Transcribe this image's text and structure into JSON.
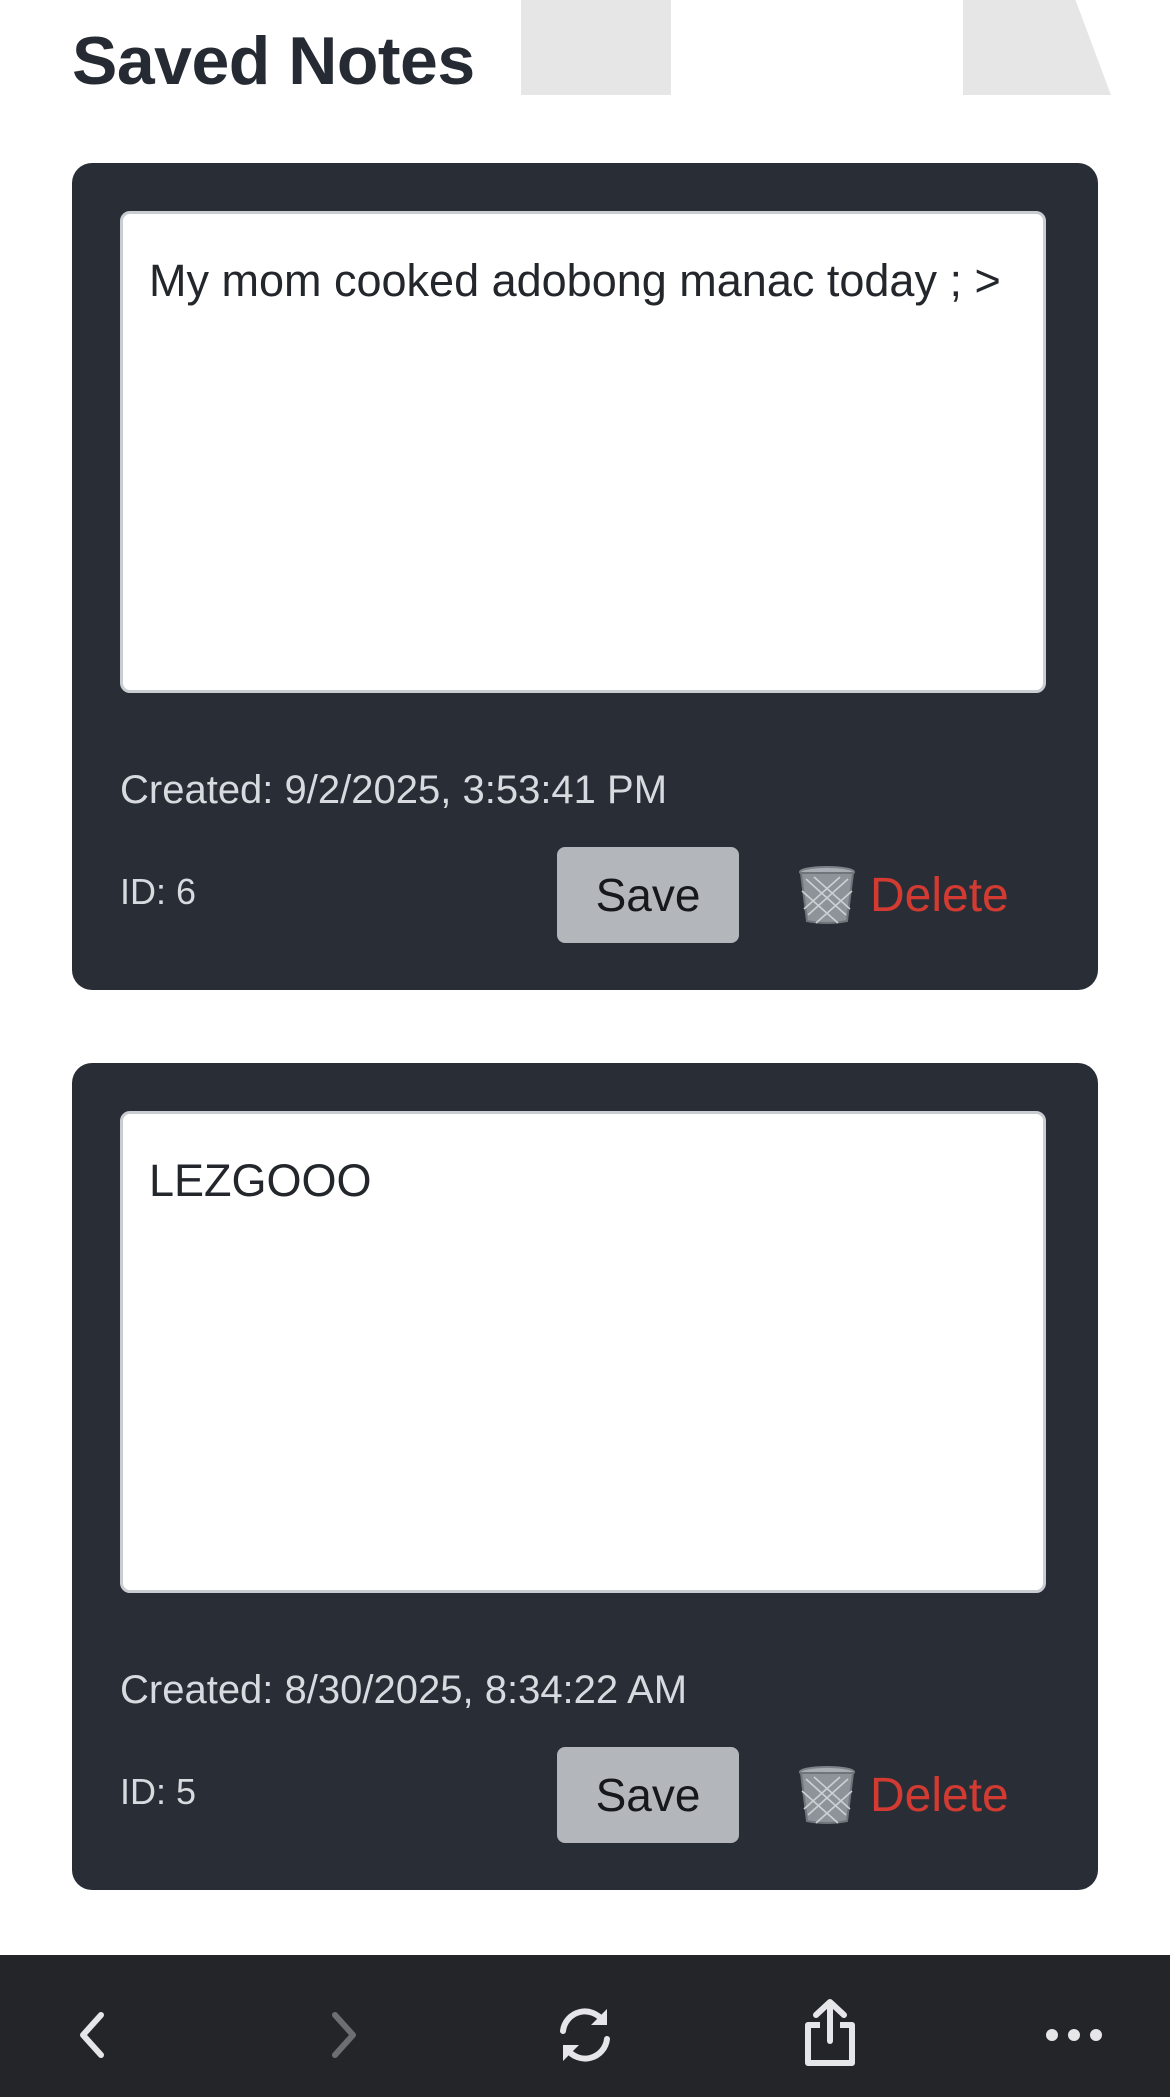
{
  "page": {
    "title": "Saved Notes"
  },
  "notes": [
    {
      "text": "My mom cooked adobong manac today ; >",
      "created": "Created: 9/2/2025, 3:53:41 PM",
      "id_label": "ID: 6",
      "save_label": "Save",
      "delete_label": "Delete"
    },
    {
      "text": "LEZGOOO",
      "created": "Created: 8/30/2025, 8:34:22 AM",
      "id_label": "ID: 5",
      "save_label": "Save",
      "delete_label": "Delete"
    }
  ],
  "toolbar": {
    "icons": [
      "back-icon",
      "forward-icon",
      "reload-icon",
      "share-icon",
      "more-icon"
    ],
    "forward_enabled": false
  },
  "colors": {
    "card_bg": "#292e36",
    "delete_red": "#d33b32",
    "toolbar_bg": "#242528"
  }
}
